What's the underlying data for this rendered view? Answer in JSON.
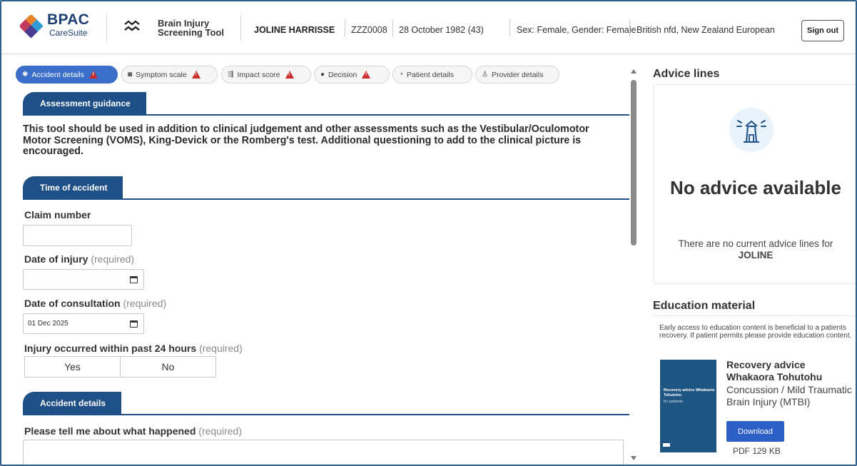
{
  "brand": {
    "title": "BPAC",
    "subtitle": "CareSuite"
  },
  "tool": {
    "name": "Brain Injury Screening Tool"
  },
  "patient": {
    "name": "JOLINE HARRISSE",
    "nhi": "ZZZ0008",
    "dob": "28 October 1982 (43)",
    "sex": "Sex: Female, Gender: Female",
    "ethnicity": "British nfd, New Zealand European"
  },
  "header": {
    "signout_label": "Sign out"
  },
  "tabs": [
    {
      "label": "Accident details",
      "icon": "accident-icon",
      "warning": true,
      "active": true
    },
    {
      "label": "Symptom scale",
      "icon": "scale-icon",
      "warning": true,
      "active": false
    },
    {
      "label": "Impact score",
      "icon": "impact-icon",
      "warning": true,
      "active": false
    },
    {
      "label": "Decision",
      "icon": "decision-icon",
      "warning": true,
      "active": false
    },
    {
      "label": "Patient details",
      "icon": "head-icon",
      "warning": false,
      "active": false
    },
    {
      "label": "Provider details",
      "icon": "person-icon",
      "warning": false,
      "active": false
    }
  ],
  "form": {
    "guidance_heading": "Assessment guidance",
    "guidance_text": "This tool should be used in addition to clinical judgement and other assessments such as the Vestibular/Oculomotor Motor Screening (VOMS), King-Devick or the Romberg's test. Additional questioning to add to the clinical picture is encouraged.",
    "time_heading": "Time of accident",
    "claim_label": "Claim number",
    "claim_value": "",
    "injury_date_label": "Date of injury",
    "required": "(required)",
    "injury_date_value": "",
    "consult_date_label": "Date of consultation",
    "consult_date_value": "01 Dec 2025",
    "within24_label": "Injury occurred within past 24 hours",
    "yes": "Yes",
    "no": "No",
    "accident_heading": "Accident details",
    "happened_label": "Please tell me about what happened",
    "happened_value": ""
  },
  "advice": {
    "title": "Advice lines",
    "empty_title": "No advice available",
    "empty_text": "There are no current advice lines for",
    "patient_first": "JOLINE"
  },
  "education": {
    "title": "Education material",
    "intro": "Early access to education content is beneficial to a patients recovery. If patient permits please provide education content.",
    "book_cover_title": "Recovery advice Whakaora Tohutohu",
    "book_cover_sub": "for patients",
    "item_title_1": "Recovery advice",
    "item_title_2": "Whakaora Tohutohu",
    "item_desc": "Concussion / Mild Traumatic Brain Injury (MTBI)",
    "download_label": "Download",
    "file_size": "PDF 129 KB"
  },
  "colors": {
    "brand_navy": "#1d3f72",
    "section_blue": "#1e4f86",
    "tab_active": "#3a6ec8",
    "warning_red": "#c92a2a",
    "download_blue": "#2d5fc5"
  }
}
